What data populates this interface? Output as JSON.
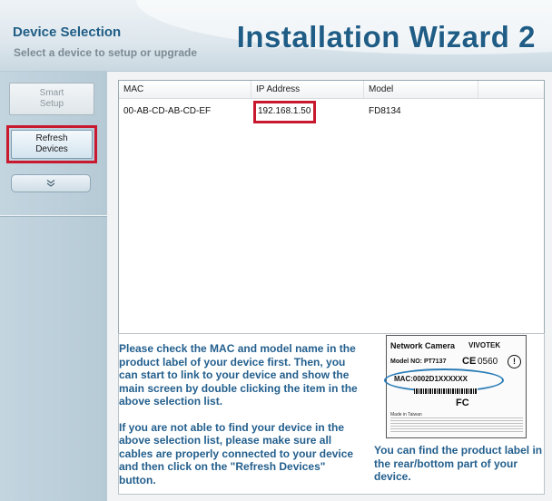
{
  "header": {
    "section_title": "Device Selection",
    "section_subtitle": "Select a device to setup or upgrade",
    "wizard_title": "Installation Wizard 2"
  },
  "sidebar": {
    "smart_setup_label": "Smart\nSetup",
    "refresh_label": "Refresh\nDevices",
    "expand_icon": "chevron-double-down-icon"
  },
  "device_table": {
    "columns": [
      "MAC",
      "IP Address",
      "Model"
    ],
    "rows": [
      {
        "mac": "00-AB-CD-AB-CD-EF",
        "ip": "192.168.1.50",
        "model": "FD8134"
      }
    ]
  },
  "info": {
    "paragraph1": "Please check the MAC and model name in the product label of your device first. Then, you can start to link to your device and show the main screen by double clicking the item in the above selection list.",
    "paragraph2": "If you are not able to find your device in the above selection list, please make sure all cables are properly connected to your device and then click on the \"Refresh Devices\" button.",
    "label_caption": "You can find the product label in the rear/bottom part of your device."
  },
  "product_label": {
    "title": "Network Camera",
    "brand": "VIVOTEK",
    "model_line": "Model NO: PT7137",
    "ce_mark": "CE",
    "cert_number": "0560",
    "alert_symbol": "!",
    "mac_line": "MAC:0002D1XXXXXX",
    "fc_mark": "FC",
    "made_in": "Made in Taiwan"
  },
  "colors": {
    "accent_blue": "#235f8d",
    "highlight_red": "#c8192e"
  }
}
